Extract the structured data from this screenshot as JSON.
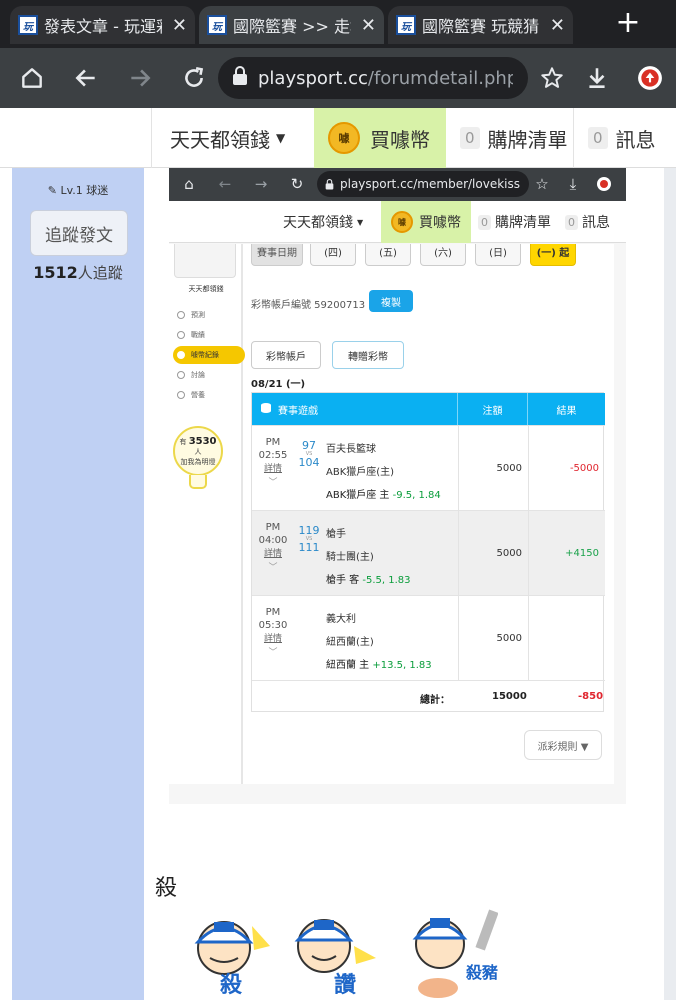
{
  "browser": {
    "tabs": [
      {
        "title": "發表文章 - 玩運彩",
        "favicon": "玩"
      },
      {
        "title": "國際籃賽 >> 走地",
        "favicon": "玩"
      },
      {
        "title": "國際籃賽 玩競猜",
        "favicon": "玩"
      }
    ],
    "url_domain": "playsport.cc",
    "url_path": "/forumdetail.php?s"
  },
  "site_header": {
    "menu_label": "天天都領錢",
    "buy_coin_label": "買噱幣",
    "coin_icon_text": "噱",
    "cart_count": "0",
    "cart_label": "購牌清單",
    "msg_count": "0",
    "msg_label": "訊息"
  },
  "sidebar": {
    "level": "Lv.1 球迷",
    "follow_button": "追蹤發文",
    "follower_count": "1512",
    "follower_suffix": "人追蹤"
  },
  "embedded": {
    "url": "playsport.cc/member/lovekiss",
    "header": {
      "menu_label": "天天都領錢",
      "buy_coin_label": "買噱幣",
      "cart_count": "0",
      "cart_label": "購牌清單",
      "msg_count": "0",
      "msg_label": "訊息"
    },
    "mini_side": {
      "name": "天天都領錢",
      "menu": [
        "預測",
        "戰績",
        "噱幣紀錄",
        "討論",
        "營養"
      ],
      "bulb_prefix": "有",
      "bulb_count": "3530",
      "bulb_unit": "人",
      "bulb_text": "加我為明燈"
    },
    "dates": [
      "賽事日期",
      "(四)",
      "(五)",
      "(六)",
      "(日)",
      "(一) 起"
    ],
    "account_label": "彩幣帳戶編號 59200713",
    "copy_label": "複製",
    "tabs": [
      "彩幣帳戶",
      "轉贈彩幣"
    ],
    "bet_date": "08/21 (一)",
    "table": {
      "headers": [
        "賽事遊戲",
        "注額",
        "結果"
      ],
      "rows": [
        {
          "ampm": "PM",
          "time": "02:55",
          "detail": "詳情",
          "score_away": "97",
          "score_home": "104",
          "vs": "VS",
          "team_away": "百夫長籃球",
          "team_home": "ABK獵戶座(主)",
          "pick": "ABK獵戶座 主",
          "line": "-9.5, 1.84",
          "amount": "5000",
          "result": "-5000"
        },
        {
          "ampm": "PM",
          "time": "04:00",
          "detail": "詳情",
          "score_away": "119",
          "score_home": "111",
          "vs": "VS",
          "team_away": "槍手",
          "team_home": "騎士團(主)",
          "pick": "槍手 客",
          "line": "-5.5, 1.83",
          "amount": "5000",
          "result": "+4150"
        },
        {
          "ampm": "PM",
          "time": "05:30",
          "detail": "詳情",
          "score_away": "",
          "score_home": "",
          "vs": "",
          "team_away": "義大利",
          "team_home": "紐西蘭(主)",
          "pick": "紐西蘭 主",
          "line": "+13.5, 1.83",
          "amount": "5000",
          "result": ""
        }
      ],
      "total_label": "總計：",
      "total_amount": "15000",
      "total_result": "-850"
    },
    "rule_button": "派彩規則 ▼"
  },
  "post": {
    "word": "殺",
    "sticker_texts": [
      "殺",
      "讚",
      "殺豬!"
    ]
  },
  "colors": {
    "accent_blue": "#0ab0f2",
    "buy_coin_bg": "#d8f2a8",
    "sidebar_bg": "#bfd0f3",
    "negative": "#e0262f",
    "positive": "#1aa24a"
  }
}
